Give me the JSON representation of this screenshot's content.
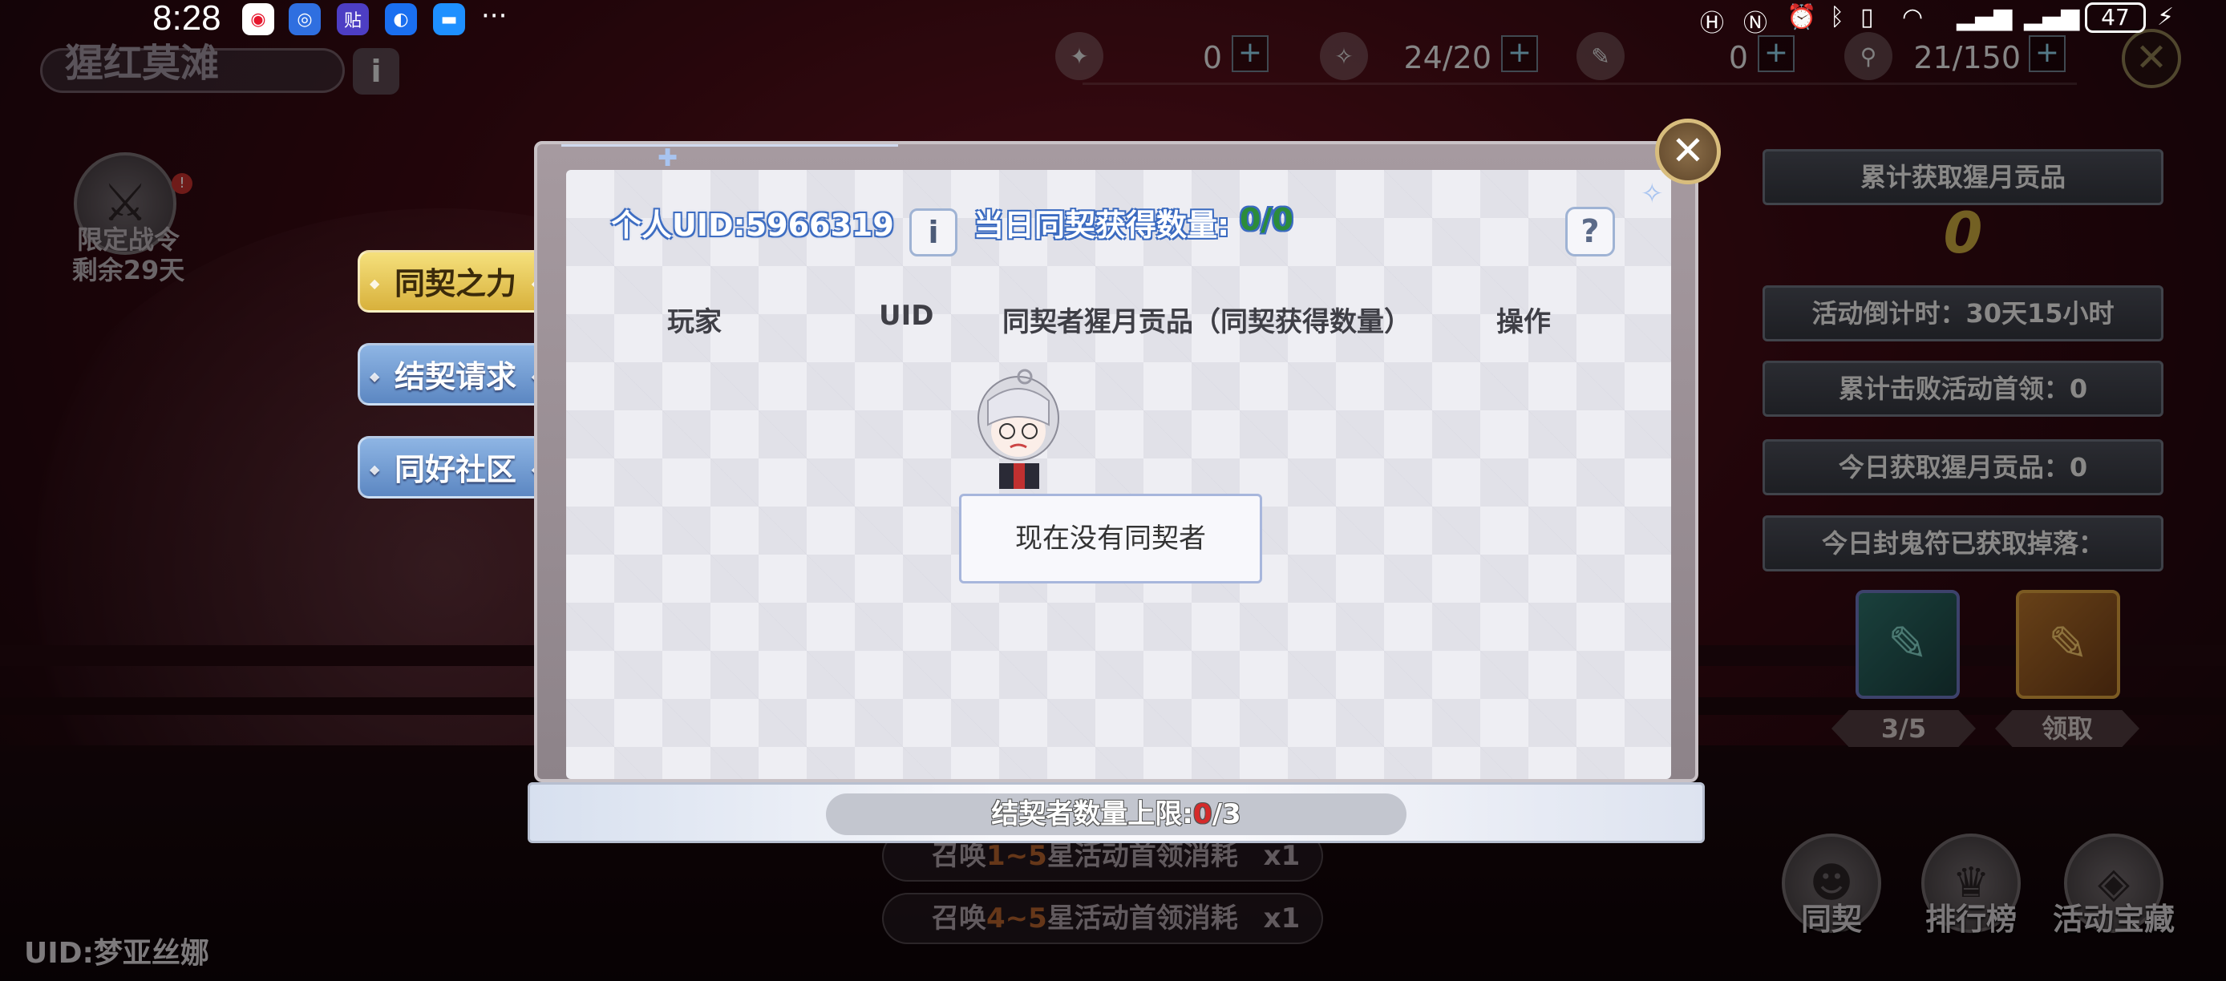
{
  "status_bar": {
    "time": "8:28",
    "dots": "···",
    "battery": "47"
  },
  "resources": [
    {
      "value": "0"
    },
    {
      "value": "24/20"
    },
    {
      "value": "0"
    },
    {
      "value": "21/150"
    }
  ],
  "area": {
    "title": "猩红莫滩"
  },
  "event_token": {
    "label_line1": "限定战令",
    "label_line2": "剩余29天",
    "badge": "!"
  },
  "tabs": [
    "同契之力",
    "结契请求",
    "同好社区"
  ],
  "right_panel": {
    "total_title": "累计获取猩月贡品",
    "total_value": "0",
    "countdown": "活动倒计时：30天15小时",
    "boss_defeated": "累计击败活动首领：0",
    "today_tributes": "今日获取猩月贡品：0",
    "seal_drops": "今日封鬼符已获取掉落：",
    "card1_tag": "3/5",
    "card2_tag": "领取"
  },
  "bottom_buttons": [
    "同契",
    "排行榜",
    "活动宝藏"
  ],
  "player_uid": "UID:梦亚丝娜",
  "summon_rows": [
    {
      "prefix": "召唤",
      "range": "1~5",
      "suffix": "星活动首领消耗",
      "count": "x1"
    },
    {
      "prefix": "召唤",
      "range": "4~5",
      "suffix": "星活动首领消耗",
      "count": "x1"
    }
  ],
  "modal": {
    "uid_label": "个人UID:5966319",
    "daily_label": "当日同契获得数量:",
    "daily_value": "0/0",
    "help": "?",
    "info": "i",
    "close": "✕",
    "columns": [
      "玩家",
      "UID",
      "同契者猩月贡品（同契获得数量）",
      "操作"
    ],
    "empty_text": "现在没有同契者",
    "cap_prefix": "结契者数量上限:",
    "cap_current": "0",
    "cap_suffix": "/3"
  },
  "colors": {
    "accent_gold": "#d8b13c",
    "tab_blue": "#5c87c2",
    "uid_blue": "#3a6ac0",
    "daily_green": "#2c8c3a",
    "cap_red": "#d52a2a"
  }
}
